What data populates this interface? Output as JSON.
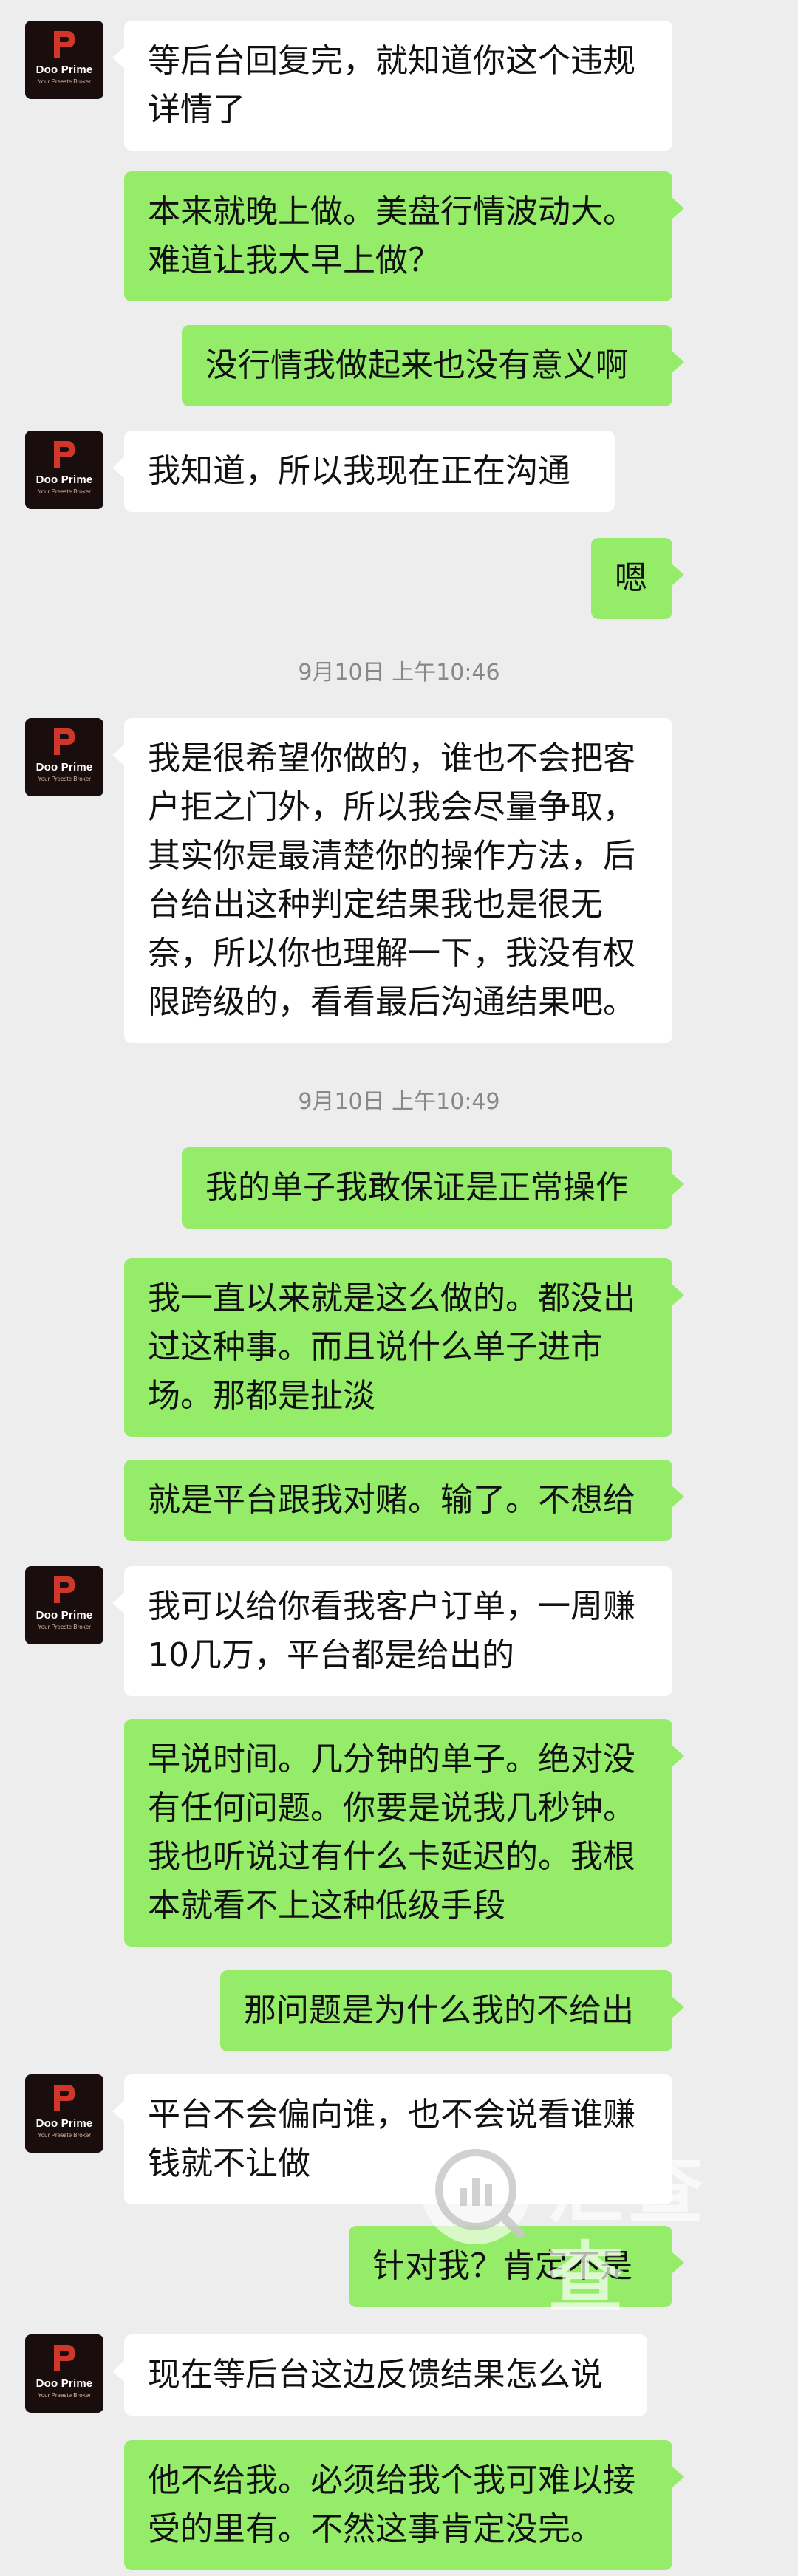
{
  "contact": {
    "brand": "Doo Prime",
    "slogan": "Your Preeste Broker",
    "logo_color": "#d0362a",
    "logo_background": "#1a0d0d"
  },
  "colors": {
    "background": "#ededed",
    "incoming_bubble": "#ffffff",
    "outgoing_bubble": "#95ec69"
  },
  "messages": [
    {
      "side": "in",
      "text": "等后台回复完，就知道你这个违规详情了"
    },
    {
      "side": "out",
      "text": "本来就晚上做。美盘行情波动大。难道让我大早上做？"
    },
    {
      "side": "out",
      "text": "没行情我做起来也没有意义啊"
    },
    {
      "side": "in",
      "text": "我知道，所以我现在正在沟通"
    },
    {
      "side": "out",
      "text": "嗯"
    },
    {
      "timestamp": "9月10日 上午10:46"
    },
    {
      "side": "in",
      "text": "我是很希望你做的，谁也不会把客户拒之门外，所以我会尽量争取，其实你是最清楚你的操作方法，后台给出这种判定结果我也是很无奈，所以你也理解一下，我没有权限跨级的，看看最后沟通结果吧。"
    },
    {
      "timestamp": "9月10日 上午10:49"
    },
    {
      "side": "out",
      "text": "我的单子我敢保证是正常操作"
    },
    {
      "side": "out",
      "text": "我一直以来就是这么做的。都没出过这种事。而且说什么单子进市场。那都是扯淡"
    },
    {
      "side": "out",
      "text": "就是平台跟我对赌。输了。不想给"
    },
    {
      "side": "in",
      "text": "我可以给你看我客户订单，一周赚10几万，平台都是给出的"
    },
    {
      "side": "out",
      "text": "早说时间。几分钟的单子。绝对没有任何问题。你要是说我几秒钟。我也听说过有什么卡延迟的。我根本就看不上这种低级手段"
    },
    {
      "side": "out",
      "text": "那问题是为什么我的不给出"
    },
    {
      "side": "in",
      "text": "平台不会偏向谁，也不会说看谁赚钱就不让做"
    },
    {
      "side": "out",
      "text": "针对我？肯定不是"
    },
    {
      "side": "in",
      "text": "现在等后台这边反馈结果怎么说"
    },
    {
      "side": "out",
      "text": "他不给我。必须给我个我可难以接受的里有。不然这事肯定没完。"
    }
  ],
  "watermark": {
    "text": "汇查查",
    "icon": "bar-chart-magnifier-icon"
  }
}
